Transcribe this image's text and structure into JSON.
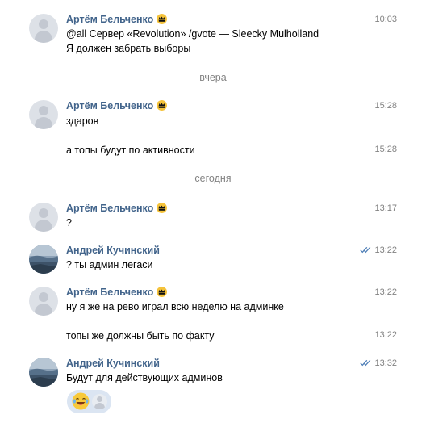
{
  "messages": [
    {
      "author": "Артём Бельченко",
      "time": "10:03",
      "lines": [
        "@all Сервер «Revolution» /gvote — Sleecky Mulholland",
        "Я должен забрать выборы"
      ]
    },
    {
      "divider": "вчера"
    },
    {
      "author": "Артём Бельченко",
      "time": "15:28",
      "lines": [
        "здаров"
      ]
    },
    {
      "time": "15:28",
      "lines": [
        "а топы будут по активности"
      ]
    },
    {
      "divider": "сегодня"
    },
    {
      "author": "Артём Бельченко",
      "time": "13:17",
      "lines": [
        "?"
      ]
    },
    {
      "author": "Андрей Кучинский",
      "time": "13:22",
      "read": true,
      "lines": [
        "? ты админ легаси"
      ]
    },
    {
      "author": "Артём Бельченко",
      "time": "13:22",
      "lines": [
        "ну я же на рево играл всю неделю на админке"
      ]
    },
    {
      "time": "13:22",
      "lines": [
        "топы же должны быть по факту"
      ]
    },
    {
      "author": "Андрей Кучинский",
      "time": "13:32",
      "read": true,
      "lines": [
        "Будут для действующих админов"
      ],
      "reaction": "laughing-emoji"
    }
  ],
  "colors": {
    "author": "#42648b",
    "time": "#828282",
    "read_check": "#5181b8",
    "reaction_bg": "#dbe5f2"
  }
}
